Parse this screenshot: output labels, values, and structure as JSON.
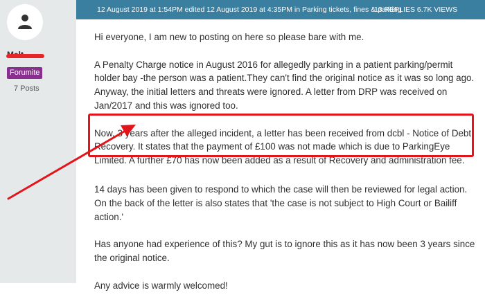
{
  "user": {
    "username": "Malt",
    "rank_badge": "Forumite",
    "post_count": "7 Posts"
  },
  "thread": {
    "meta": "12 August 2019 at 1:54PM edited 12 August 2019 at 4:35PM in Parking tickets, fines & parking",
    "stats": "13 REPLIES 6.7K VIEWS"
  },
  "post": {
    "paragraphs": [
      "Hi everyone, I am new to posting on here so please bare with me.",
      "A Penalty Charge notice in August 2016 for allegedly parking in a patient parking/permit holder bay -the person was a patient.They can't find the original notice as it was so long ago. Anyway, the initial letters and threats were ignored. A letter from DRP was received on Jan/2017 and this was ignored too.",
      "Now, 3 years after the alleged incident, a letter has been received from dcbl - Notice of Debt Recovery. It states that the payment of £100 was not made which is due to ParkingEye Limited. A further £70 has now been added as a result of Recovery and administration fee.",
      "14 days has been given to respond to which the case will then be reviewed for legal action. On the back of the letter is also states that 'the case is not subject to High Court or Bailiff action.'",
      "Has anyone had experience of this? My gut is to ignore this as it has now been 3 years since the original notice.",
      "Any advice is warmly welcomed!"
    ]
  },
  "colors": {
    "header_bar": "#3a7fa0",
    "sidebar": "#e5e9ea",
    "badge": "#8a2f90",
    "annotation_red": "#e3151b"
  }
}
